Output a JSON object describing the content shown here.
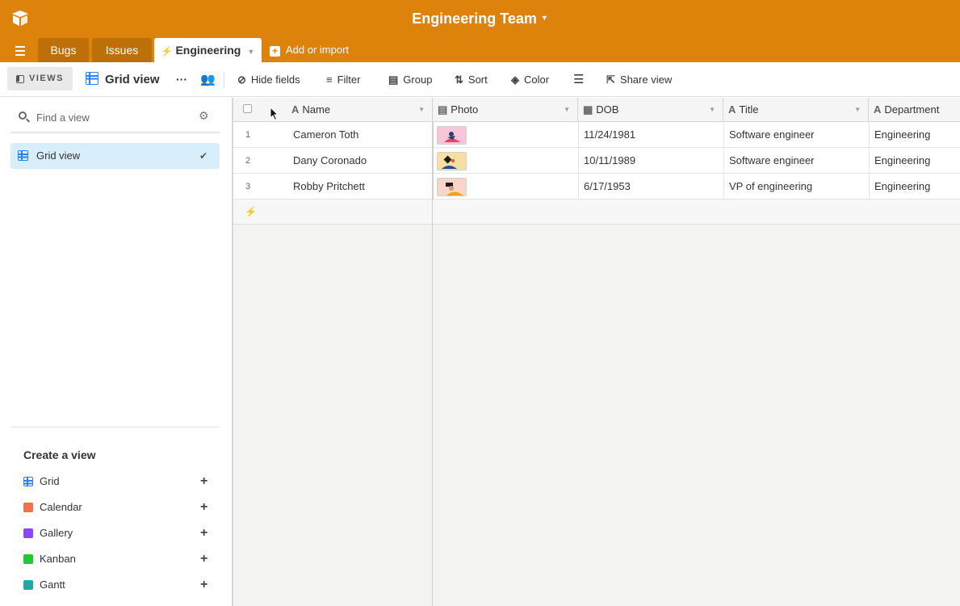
{
  "header": {
    "base_title": "Engineering Team",
    "tabs": [
      {
        "label": "Bugs"
      },
      {
        "label": "Issues"
      },
      {
        "label": "Engineering"
      }
    ],
    "add_import_label": "Add or import",
    "brand_color": "#dd830c"
  },
  "toolbar": {
    "views_label": "VIEWS",
    "view_name": "Grid view",
    "hide_fields": "Hide fields",
    "filter": "Filter",
    "group": "Group",
    "sort": "Sort",
    "color": "Color",
    "share_view": "Share view"
  },
  "sidebar": {
    "search_placeholder": "Find a view",
    "views": [
      {
        "label": "Grid view"
      }
    ],
    "create_title": "Create a view",
    "create_items": [
      {
        "label": "Grid",
        "icon": "grid-icon",
        "color": "#2d7ff9"
      },
      {
        "label": "Calendar",
        "icon": "calendar-icon",
        "color": "#f46f4f"
      },
      {
        "label": "Gallery",
        "icon": "gallery-icon",
        "color": "#8b46ff"
      },
      {
        "label": "Kanban",
        "icon": "kanban-icon",
        "color": "#20c933"
      },
      {
        "label": "Gantt",
        "icon": "gantt-icon",
        "color": "#20a7a7"
      }
    ]
  },
  "table": {
    "columns": [
      {
        "label": "Name",
        "icon": "text-field-icon"
      },
      {
        "label": "Photo",
        "icon": "attachment-field-icon"
      },
      {
        "label": "DOB",
        "icon": "date-field-icon"
      },
      {
        "label": "Title",
        "icon": "text-field-icon"
      },
      {
        "label": "Department",
        "icon": "text-field-icon"
      }
    ],
    "rows": [
      {
        "num": "1",
        "name": "Cameron Toth",
        "photo_bg": "#f7c6d9",
        "dob": "11/24/1981",
        "title": "Software engineer",
        "department": "Engineering"
      },
      {
        "num": "2",
        "name": "Dany Coronado",
        "photo_bg": "#f6dfa0",
        "dob": "10/11/1989",
        "title": "Software engineer",
        "department": "Engineering"
      },
      {
        "num": "3",
        "name": "Robby Pritchett",
        "photo_bg": "#f8d5c8",
        "dob": "6/17/1953",
        "title": "VP of engineering",
        "department": "Engineering"
      }
    ]
  }
}
